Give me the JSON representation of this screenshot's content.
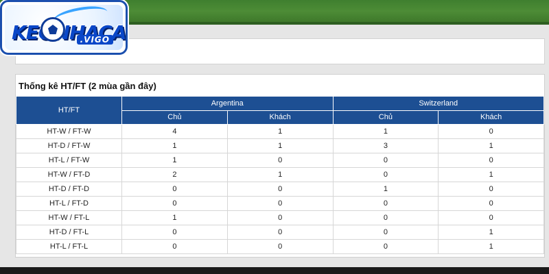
{
  "logo": {
    "text": "KEONHACAI",
    "sub": ".VIGO"
  },
  "stats": {
    "title": "Thống kê HT/FT (2 mùa gần đây)",
    "row_header": "HT/FT",
    "teams": [
      "Argentina",
      "Switzerland"
    ],
    "sub_headers": [
      "Chủ",
      "Khách",
      "Chủ",
      "Khách"
    ],
    "rows": [
      {
        "label": "HT-W / FT-W",
        "values": [
          "4",
          "1",
          "1",
          "0"
        ]
      },
      {
        "label": "HT-D / FT-W",
        "values": [
          "1",
          "1",
          "3",
          "1"
        ]
      },
      {
        "label": "HT-L / FT-W",
        "values": [
          "1",
          "0",
          "0",
          "0"
        ]
      },
      {
        "label": "HT-W / FT-D",
        "values": [
          "2",
          "1",
          "0",
          "1"
        ]
      },
      {
        "label": "HT-D / FT-D",
        "values": [
          "0",
          "0",
          "1",
          "0"
        ]
      },
      {
        "label": "HT-L / FT-D",
        "values": [
          "0",
          "0",
          "0",
          "0"
        ]
      },
      {
        "label": "HT-W / FT-L",
        "values": [
          "1",
          "0",
          "0",
          "0"
        ]
      },
      {
        "label": "HT-D / FT-L",
        "values": [
          "0",
          "0",
          "0",
          "1"
        ]
      },
      {
        "label": "HT-L / FT-L",
        "values": [
          "0",
          "0",
          "0",
          "1"
        ]
      }
    ]
  },
  "colors": {
    "header_bg": "#1d4f93",
    "page_bg": "#e6e6e6",
    "grass": "#4d8c36"
  }
}
